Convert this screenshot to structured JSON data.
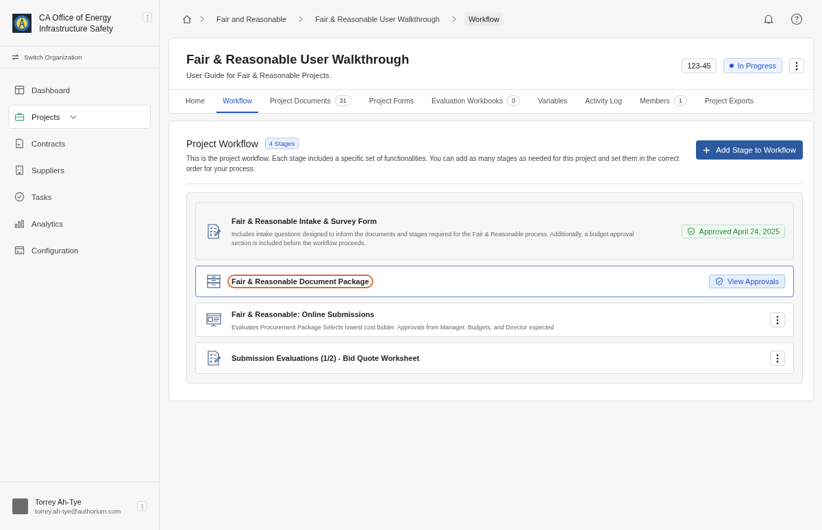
{
  "org": {
    "name": "CA Office of Energy Infrastructure Safety",
    "switch_label": "Switch Organization"
  },
  "nav": [
    {
      "label": "Dashboard",
      "kind": "dashboard",
      "selected": false
    },
    {
      "label": "Projects",
      "kind": "projects",
      "selected": true,
      "expandable": true
    },
    {
      "label": "Contracts",
      "kind": "contracts",
      "selected": false
    },
    {
      "label": "Suppliers",
      "kind": "suppliers",
      "selected": false
    },
    {
      "label": "Tasks",
      "kind": "tasks",
      "selected": false
    },
    {
      "label": "Analytics",
      "kind": "analytics",
      "selected": false
    },
    {
      "label": "Configuration",
      "kind": "configuration",
      "selected": false
    }
  ],
  "user": {
    "name": "Torrey Ah-Tye",
    "email": "torrey.ah-tye@authorium.com"
  },
  "breadcrumbs": [
    {
      "label": "Fair and Reasonable",
      "current": false
    },
    {
      "label": "Fair & Reasonable User Walkthrough",
      "current": false
    },
    {
      "label": "Workflow",
      "current": true
    }
  ],
  "project": {
    "title": "Fair & Reasonable User Walkthrough",
    "subtitle": "User Guide for Fair & Reasonable Projects.",
    "number": "123-45",
    "status": "In Progress"
  },
  "tabs": [
    {
      "label": "Home",
      "selected": false
    },
    {
      "label": "Workflow",
      "selected": true
    },
    {
      "label": "Project Documents",
      "count": "31",
      "selected": false
    },
    {
      "label": "Project Forms",
      "selected": false
    },
    {
      "label": "Evaluation Workbooks",
      "count": "0",
      "selected": false
    },
    {
      "label": "Variables",
      "selected": false
    },
    {
      "label": "Activity Log",
      "selected": false
    },
    {
      "label": "Members",
      "count": "1",
      "selected": false
    },
    {
      "label": "Project Exports",
      "selected": false
    }
  ],
  "workflow": {
    "title": "Project Workflow",
    "badge": "4 Stages",
    "description": "This is the project workflow. Each stage includes a specific set of functionalities. You can add as many stages as needed for this project and set them in the correct order for your process.",
    "add_button": "Add Stage to Workflow",
    "stages": [
      {
        "kind": "form",
        "title": "Fair & Reasonable Intake & Survey Form",
        "description": "Includes intake questions designed to inform the documents and stages required for the Fair & Reasonable process. Additionally, a budget approval section is included before the workflow proceeds.",
        "action": {
          "kind": "approved",
          "label": "Approved April 24, 2025"
        },
        "selected": false,
        "completed": true,
        "highlighted": false
      },
      {
        "kind": "cabinet",
        "title": "Fair & Reasonable Document Package",
        "action": {
          "kind": "approvals",
          "label": "View Approvals"
        },
        "selected": true,
        "completed": false,
        "highlighted": true
      },
      {
        "kind": "web",
        "title": "Fair & Reasonable: Online Submissions",
        "description": "Evaluates Procurement Package Selects lowest cost bidder. Approvals from Manager, Budgets, and Director expected",
        "action": {
          "kind": "menu"
        },
        "selected": false,
        "completed": false,
        "highlighted": false
      },
      {
        "kind": "form",
        "title": "Submission Evaluations (1/2) - Bid Quote Worksheet",
        "action": {
          "kind": "menu"
        },
        "selected": false,
        "completed": false,
        "highlighted": false
      }
    ]
  }
}
